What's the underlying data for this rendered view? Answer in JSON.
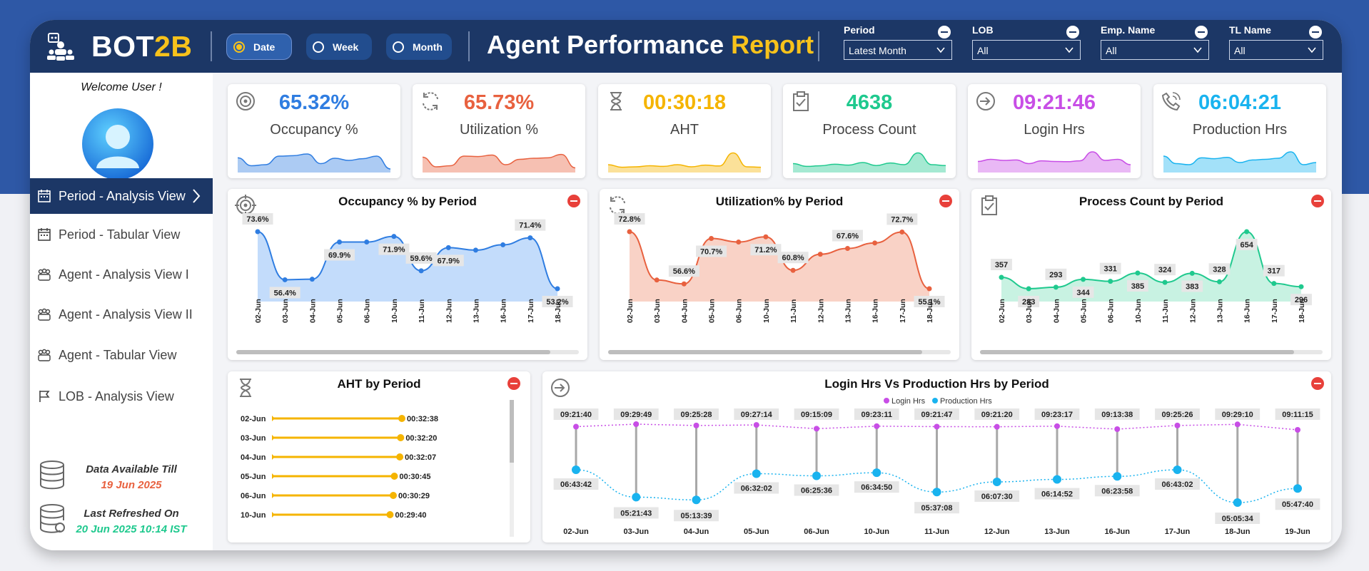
{
  "brand": {
    "part1": "BOT",
    "part2": "2B"
  },
  "report_title": {
    "part1": "Agent Performance",
    "part2": "Report"
  },
  "granularity": [
    {
      "label": "Date",
      "selected": true
    },
    {
      "label": "Week",
      "selected": false
    },
    {
      "label": "Month",
      "selected": false
    }
  ],
  "filters": [
    {
      "label": "Period",
      "value": "Latest Month"
    },
    {
      "label": "LOB",
      "value": "All"
    },
    {
      "label": "Emp. Name",
      "value": "All"
    },
    {
      "label": "TL Name",
      "value": "All"
    }
  ],
  "sidebar": {
    "welcome": "Welcome User !",
    "nav": [
      {
        "label": "Period - Analysis View",
        "icon": "calendar-icon",
        "active": true
      },
      {
        "label": "Period - Tabular View",
        "icon": "calendar-icon",
        "active": false
      },
      {
        "label": "Agent - Analysis View I",
        "icon": "team-icon",
        "active": false
      },
      {
        "label": "Agent - Analysis View II",
        "icon": "team-icon",
        "active": false
      },
      {
        "label": "Agent - Tabular View",
        "icon": "team-icon",
        "active": false
      },
      {
        "label": "LOB - Analysis View",
        "icon": "flag-icon",
        "active": false
      }
    ],
    "data_available_label": "Data Available Till",
    "data_available_value": "19 Jun 2025",
    "last_refreshed_label": "Last Refreshed On",
    "last_refreshed_value": "20 Jun 2025 10:14 IST"
  },
  "kpis": [
    {
      "value": "65.32%",
      "label": "Occupancy %",
      "color": "#2f7de1",
      "icon": "target-icon"
    },
    {
      "value": "65.73%",
      "label": "Utilization %",
      "color": "#e8613f",
      "icon": "refresh-icon"
    },
    {
      "value": "00:30:18",
      "label": "AHT",
      "color": "#f5b400",
      "icon": "hourglass-icon"
    },
    {
      "value": "4638",
      "label": "Process Count",
      "color": "#1fc98e",
      "icon": "clipboard-check-icon"
    },
    {
      "value": "09:21:46",
      "label": "Login Hrs",
      "color": "#c84ee6",
      "icon": "login-icon"
    },
    {
      "value": "06:04:21",
      "label": "Production Hrs",
      "color": "#19b3ef",
      "icon": "phone-icon"
    }
  ],
  "chart_data": [
    {
      "type": "area",
      "title": "Occupancy % by Period",
      "categories": [
        "02-Jun",
        "03-Jun",
        "04-Jun",
        "05-Jun",
        "06-Jun",
        "10-Jun",
        "11-Jun",
        "12-Jun",
        "13-Jun",
        "16-Jun",
        "17-Jun",
        "18-Jun"
      ],
      "values": [
        73.6,
        56.4,
        56.6,
        69.9,
        69.9,
        71.9,
        59.6,
        67.9,
        67.0,
        68.9,
        71.4,
        53.2
      ],
      "data_labels": {
        "0": "73.6%",
        "1": "56.4%",
        "3": "69.9%",
        "5": "71.9%",
        "6": "59.6%",
        "7": "67.9%",
        "10": "71.4%",
        "11": "53.2%"
      },
      "color": "#2f7de1",
      "fill": "#c3dcfb"
    },
    {
      "type": "area",
      "title": "Utilization% by Period",
      "categories": [
        "02-Jun",
        "03-Jun",
        "04-Jun",
        "05-Jun",
        "06-Jun",
        "10-Jun",
        "11-Jun",
        "12-Jun",
        "13-Jun",
        "16-Jun",
        "17-Jun",
        "18-Jun"
      ],
      "values": [
        72.8,
        57.8,
        56.6,
        70.7,
        69.6,
        71.2,
        60.8,
        65.8,
        67.6,
        69.3,
        72.7,
        55.1
      ],
      "data_labels": {
        "0": "72.8%",
        "2": "56.6%",
        "3": "70.7%",
        "5": "71.2%",
        "6": "60.8%",
        "8": "67.6%",
        "10": "72.7%",
        "11": "55.1%"
      },
      "color": "#e8613f",
      "fill": "#f9d2c6"
    },
    {
      "type": "area",
      "title": "Process Count by Period",
      "categories": [
        "02-Jun",
        "03-Jun",
        "04-Jun",
        "05-Jun",
        "06-Jun",
        "10-Jun",
        "11-Jun",
        "12-Jun",
        "13-Jun",
        "16-Jun",
        "17-Jun",
        "18-Jun"
      ],
      "values": [
        357,
        283,
        293,
        344,
        331,
        385,
        324,
        383,
        328,
        654,
        317,
        296
      ],
      "data_labels": {
        "0": "357",
        "1": "283",
        "2": "293",
        "3": "344",
        "4": "331",
        "5": "385",
        "6": "324",
        "7": "383",
        "8": "328",
        "9": "654",
        "10": "317",
        "11": "296"
      },
      "color": "#1fc98e",
      "fill": "#c8f2e2"
    },
    {
      "type": "bar",
      "title": "AHT by Period",
      "orientation": "horizontal",
      "categories": [
        "02-Jun",
        "03-Jun",
        "04-Jun",
        "05-Jun",
        "06-Jun",
        "10-Jun"
      ],
      "values_seconds": [
        1958,
        1940,
        1927,
        1845,
        1829,
        1780
      ],
      "value_labels": [
        "00:32:38",
        "00:32:20",
        "00:32:07",
        "00:30:45",
        "00:30:29",
        "00:29:40"
      ],
      "color": "#f5b400"
    },
    {
      "type": "line",
      "title": "Login Hrs Vs Production Hrs by Period",
      "categories": [
        "02-Jun",
        "03-Jun",
        "04-Jun",
        "05-Jun",
        "06-Jun",
        "10-Jun",
        "11-Jun",
        "12-Jun",
        "13-Jun",
        "16-Jun",
        "17-Jun",
        "18-Jun",
        "19-Jun"
      ],
      "series": [
        {
          "name": "Login Hrs",
          "color": "#c84ee6",
          "values_hours": [
            9.361,
            9.497,
            9.424,
            9.454,
            9.251,
            9.386,
            9.363,
            9.356,
            9.388,
            9.227,
            9.424,
            9.486,
            9.188
          ],
          "labels": [
            "09:21:40",
            "09:29:49",
            "09:25:28",
            "09:27:14",
            "09:15:09",
            "09:23:11",
            "09:21:47",
            "09:21:20",
            "09:23:17",
            "09:13:38",
            "09:25:26",
            "09:29:10",
            "09:11:15"
          ]
        },
        {
          "name": "Production Hrs",
          "color": "#19b3ef",
          "values_hours": [
            6.729,
            5.362,
            5.227,
            6.534,
            6.427,
            6.581,
            5.619,
            6.125,
            6.248,
            6.399,
            6.728,
            5.093,
            5.796
          ],
          "labels": [
            "06:43:42",
            "05:21:43",
            "05:13:39",
            "06:32:02",
            "06:25:36",
            "06:34:50",
            "05:37:08",
            "06:07:30",
            "06:14:52",
            "06:23:58",
            "06:43:02",
            "05:05:34",
            "05:47:40"
          ]
        }
      ]
    }
  ],
  "sparks": [
    [
      0.62,
      0.25,
      0.3,
      0.7,
      0.72,
      0.8,
      0.35,
      0.6,
      0.5,
      0.58,
      0.7,
      0.1
    ],
    [
      0.65,
      0.2,
      0.25,
      0.7,
      0.68,
      0.75,
      0.3,
      0.55,
      0.6,
      0.62,
      0.78,
      0.15
    ],
    [
      0.3,
      0.18,
      0.2,
      0.25,
      0.22,
      0.3,
      0.2,
      0.28,
      0.24,
      0.85,
      0.2,
      0.18
    ],
    [
      0.35,
      0.22,
      0.25,
      0.32,
      0.28,
      0.4,
      0.26,
      0.38,
      0.3,
      0.85,
      0.3,
      0.26
    ],
    [
      0.45,
      0.55,
      0.5,
      0.52,
      0.35,
      0.48,
      0.45,
      0.44,
      0.48,
      0.9,
      0.5,
      0.55,
      0.3
    ],
    [
      0.7,
      0.35,
      0.3,
      0.62,
      0.58,
      0.64,
      0.4,
      0.52,
      0.55,
      0.6,
      0.9,
      0.3,
      0.4
    ]
  ]
}
